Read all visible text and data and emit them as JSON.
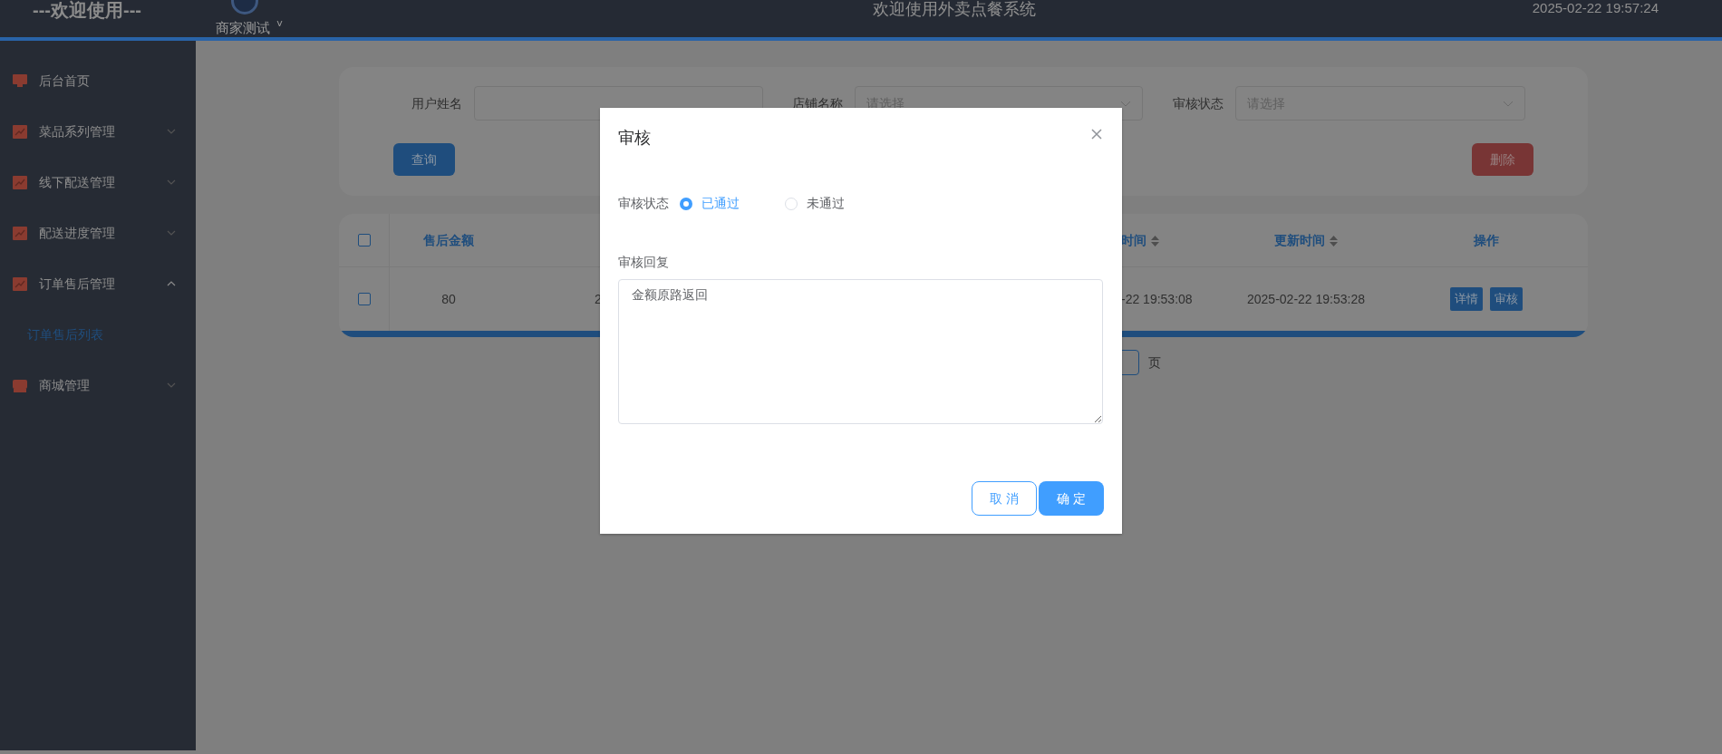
{
  "header": {
    "brand": "---欢迎使用---",
    "user": "商家测试",
    "user_caret": "˅",
    "title": "欢迎使用外卖点餐系统",
    "datetime": "2025-02-22 19:57:24"
  },
  "sidebar": {
    "items": [
      {
        "label": "后台首页",
        "kind": "page"
      },
      {
        "label": "菜品系列管理",
        "kind": "group",
        "expanded": false
      },
      {
        "label": "线下配送管理",
        "kind": "group",
        "expanded": false
      },
      {
        "label": "配送进度管理",
        "kind": "group",
        "expanded": false
      },
      {
        "label": "订单售后管理",
        "kind": "group",
        "expanded": true,
        "children": [
          {
            "label": "订单售后列表",
            "selected": true
          }
        ]
      },
      {
        "label": "商城管理",
        "kind": "store",
        "expanded": false
      }
    ]
  },
  "filters": [
    {
      "label": "用户姓名",
      "kind": "input"
    },
    {
      "label": "店铺名称",
      "kind": "select",
      "placeholder": "请选择"
    },
    {
      "label": "审核状态",
      "kind": "select",
      "placeholder": "请选择"
    }
  ],
  "filter_buttons": {
    "query": "查询",
    "delete": "删除"
  },
  "table": {
    "select_all_checked": false,
    "columns": [
      {
        "label": "售后金额",
        "kind": "plain"
      },
      {
        "kind": "plain"
      },
      {
        "label": "时间",
        "kind": "sortable"
      },
      {
        "label": "更新时间",
        "kind": "sortable"
      },
      {
        "label": "操作",
        "kind": "plain"
      }
    ],
    "rows": [
      {
        "checked": false,
        "cells": [
          "80",
          "2",
          "-22 19:53:08",
          "2025-02-22 19:53:28"
        ],
        "actions": [
          "详情",
          "审核"
        ]
      }
    ]
  },
  "pagination": {
    "suffix": "页"
  },
  "dialog": {
    "title": "审核",
    "status_label": "审核状态",
    "options": [
      {
        "label": "已通过",
        "selected": true
      },
      {
        "label": "未通过",
        "selected": false
      }
    ],
    "reply_label": "审核回复",
    "reply": "金额原路返回",
    "buttons": {
      "cancel": "取 消",
      "confirm": "确 定"
    }
  }
}
